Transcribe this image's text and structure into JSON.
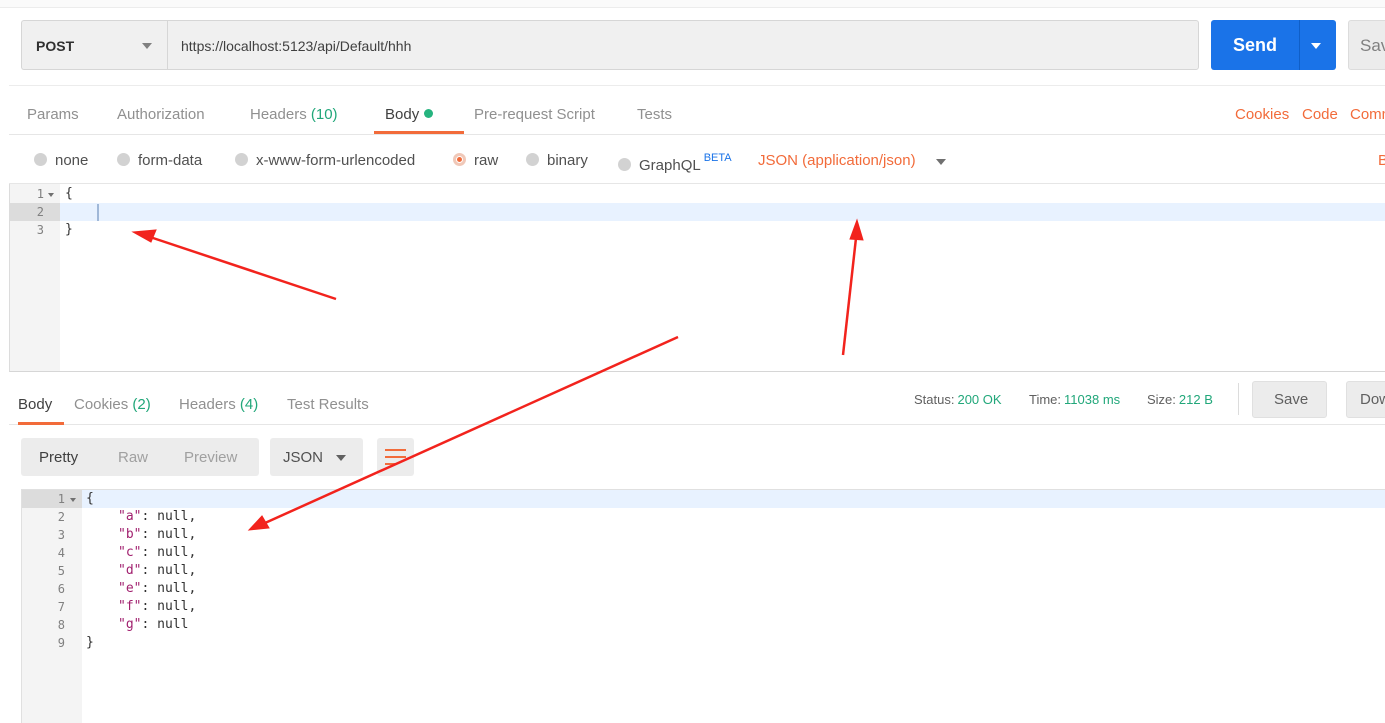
{
  "request": {
    "method": "POST",
    "url": "https://localhost:5123/api/Default/hhh",
    "send_label": "Send",
    "save_label": "Sav"
  },
  "request_tabs": {
    "params": "Params",
    "authorization": "Authorization",
    "headers": "Headers",
    "headers_count": "(10)",
    "body": "Body",
    "pre_request": "Pre-request Script",
    "tests": "Tests"
  },
  "request_links": {
    "cookies": "Cookies",
    "code": "Code",
    "comments": "Comm"
  },
  "body_types": {
    "none": "none",
    "form_data": "form-data",
    "urlencoded": "x-www-form-urlencoded",
    "raw": "raw",
    "binary": "binary",
    "graphql": "GraphQL",
    "graphql_badge": "BETA",
    "selected": "raw",
    "content_type": "JSON (application/json)",
    "beautify": "B"
  },
  "request_body": {
    "line_numbers": [
      "1",
      "2",
      "3"
    ],
    "lines": [
      "{",
      "",
      "}"
    ]
  },
  "response_tabs": {
    "body": "Body",
    "cookies": "Cookies",
    "cookies_count": "(2)",
    "headers": "Headers",
    "headers_count": "(4)",
    "test_results": "Test Results"
  },
  "response_status": {
    "status_label": "Status:",
    "status_value": "200 OK",
    "time_label": "Time:",
    "time_value": "11038 ms",
    "size_label": "Size:",
    "size_value": "212 B",
    "save_label": "Save",
    "download_label": "Dow"
  },
  "response_view": {
    "pretty": "Pretty",
    "raw": "Raw",
    "preview": "Preview",
    "format": "JSON"
  },
  "response_body": {
    "line_numbers": [
      "1",
      "2",
      "3",
      "4",
      "5",
      "6",
      "7",
      "8",
      "9"
    ],
    "open": "{",
    "close": "}",
    "entries": [
      {
        "key": "\"a\"",
        "rest": ": null,"
      },
      {
        "key": "\"b\"",
        "rest": ": null,"
      },
      {
        "key": "\"c\"",
        "rest": ": null,"
      },
      {
        "key": "\"d\"",
        "rest": ": null,"
      },
      {
        "key": "\"e\"",
        "rest": ": null,"
      },
      {
        "key": "\"f\"",
        "rest": ": null,"
      },
      {
        "key": "\"g\"",
        "rest": ": null"
      }
    ]
  },
  "colors": {
    "accent": "#f26b3a",
    "send": "#1a73e8",
    "count": "#21a77a",
    "annotation_arrow": "#f2231d"
  }
}
